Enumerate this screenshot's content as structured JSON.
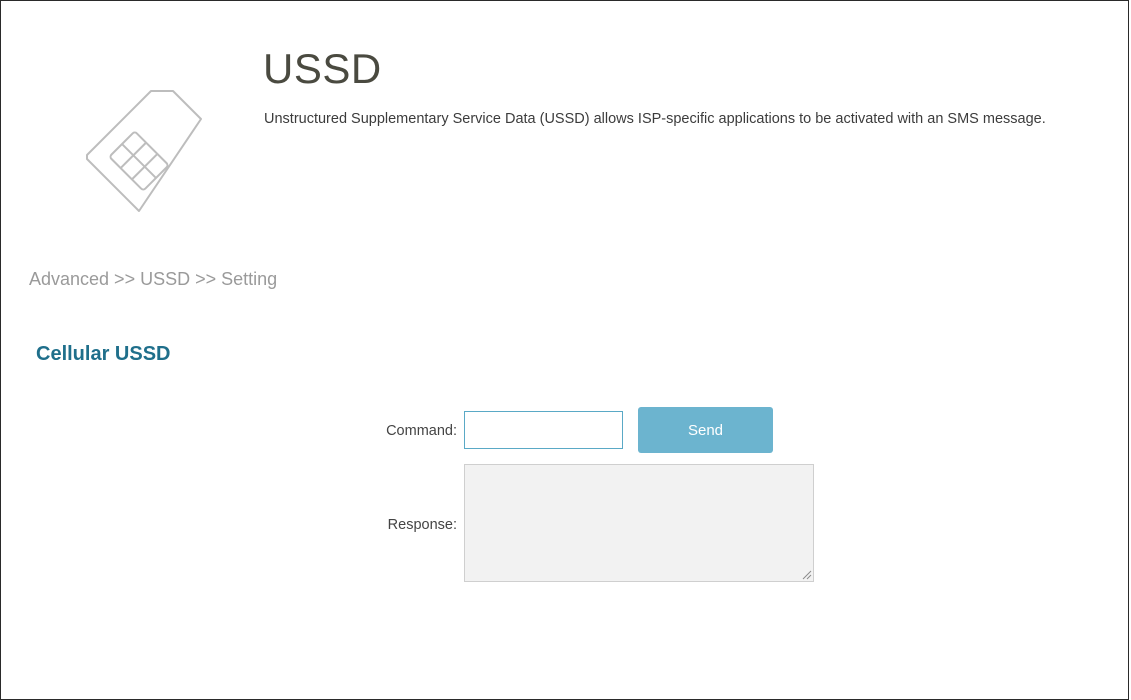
{
  "header": {
    "title": "USSD",
    "description": "Unstructured Supplementary Service Data (USSD) allows ISP-specific applications to be activated with an SMS message.",
    "icon": "sim-card-icon"
  },
  "breadcrumb": "Advanced >> USSD >> Setting",
  "section": {
    "title": "Cellular USSD"
  },
  "form": {
    "command_label": "Command:",
    "command_value": "",
    "send_label": "Send",
    "response_label": "Response:",
    "response_value": ""
  },
  "colors": {
    "accent": "#1f6f8b",
    "button": "#6cb4cf",
    "input_border": "#5aa9c6"
  }
}
